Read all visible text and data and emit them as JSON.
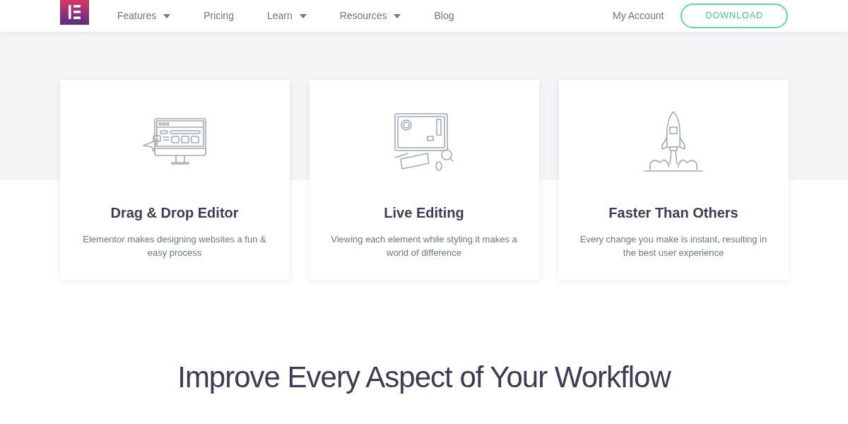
{
  "nav": {
    "items": [
      {
        "label": "Features",
        "kind": "dropdown"
      },
      {
        "label": "Pricing",
        "kind": "link"
      },
      {
        "label": "Learn",
        "kind": "dropdown"
      },
      {
        "label": "Resources",
        "kind": "dropdown"
      },
      {
        "label": "Blog",
        "kind": "link"
      }
    ],
    "account": "My Account",
    "download": "DOWNLOAD"
  },
  "features": [
    {
      "kind": "monitor",
      "title": "Drag & Drop Editor",
      "text": "Elementor makes designing websites a fun & easy process"
    },
    {
      "kind": "tablet",
      "title": "Live Editing",
      "text": "Viewing each element while styling it makes a world of difference"
    },
    {
      "kind": "rocket",
      "title": "Faster Than Others",
      "text": "Every change you make is instant, resulting in the best user experience"
    }
  ],
  "heading": "Improve Every Aspect of Your Workflow"
}
